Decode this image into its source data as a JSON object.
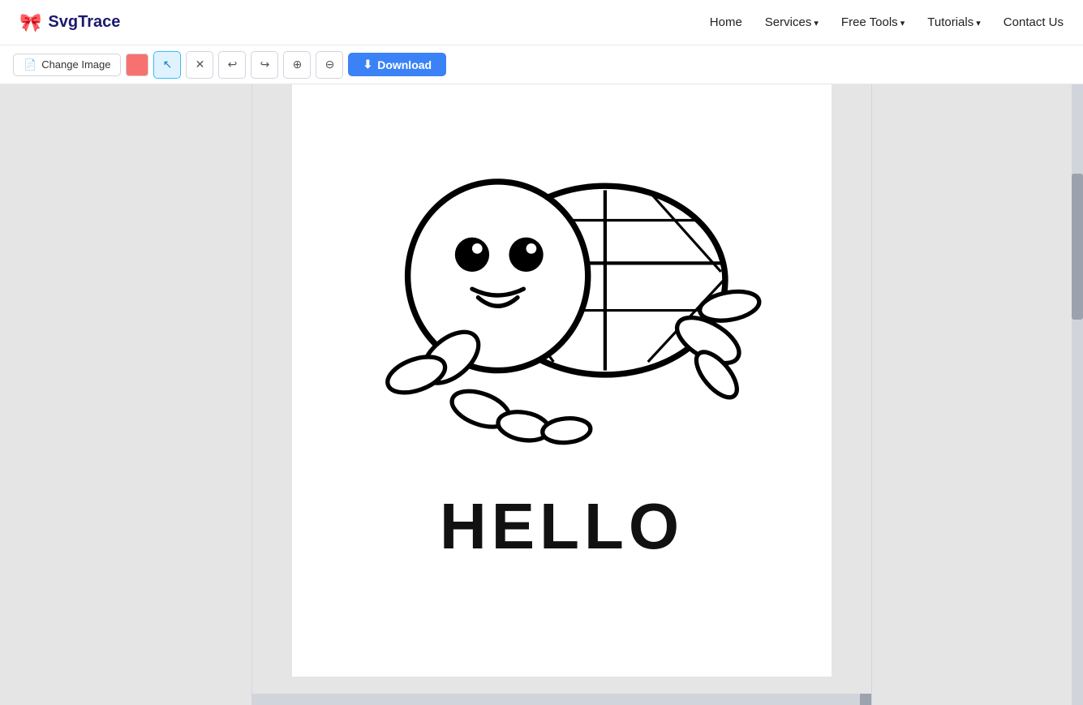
{
  "brand": {
    "logo_icon": "🎀",
    "logo_text": "SvgTrace"
  },
  "nav": {
    "links": [
      {
        "label": "Home",
        "has_arrow": false
      },
      {
        "label": "Services",
        "has_arrow": true
      },
      {
        "label": "Free Tools",
        "has_arrow": true
      },
      {
        "label": "Tutorials",
        "has_arrow": true
      },
      {
        "label": "Contact Us",
        "has_arrow": false
      }
    ]
  },
  "toolbar": {
    "change_image_label": "Change Image",
    "color_swatch": "#f87171",
    "download_label": "Download",
    "undo_icon": "↩",
    "redo_icon": "↪",
    "zoom_in_icon": "⊕",
    "zoom_out_icon": "⊖",
    "pointer_icon": "↖",
    "eraser_icon": "✕"
  },
  "canvas": {
    "hello_text": "HELLO"
  }
}
